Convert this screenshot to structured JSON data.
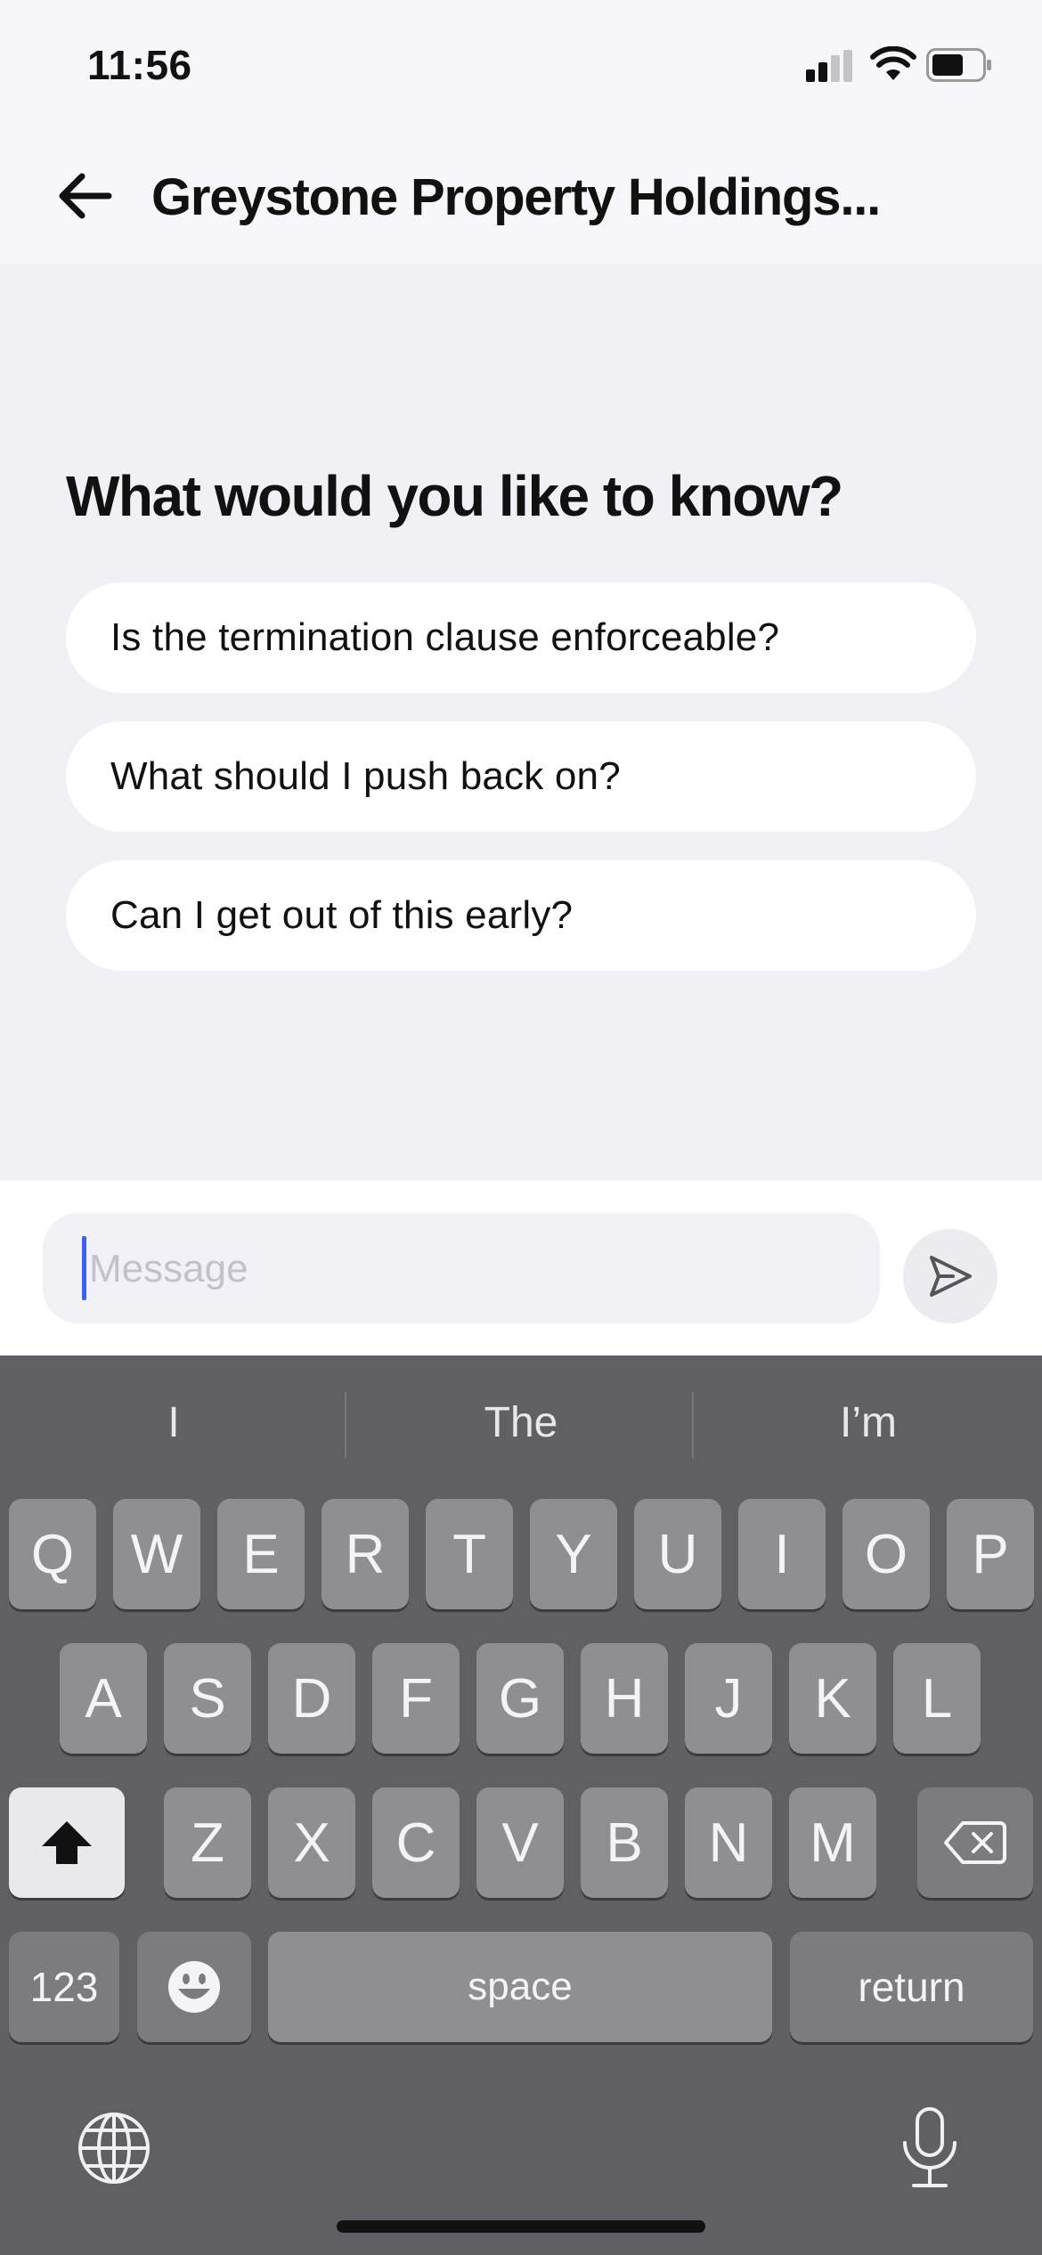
{
  "status_bar": {
    "time": "11:56"
  },
  "header": {
    "title": "Greystone Property Holdings..."
  },
  "main": {
    "prompt": "What would you like to know?",
    "suggestions": [
      "Is the termination clause enforceable?",
      "What should I push back on?",
      "Can I get out of this early?"
    ]
  },
  "composer": {
    "placeholder": "Message"
  },
  "keyboard": {
    "predictions": [
      "I",
      "The",
      "I’m"
    ],
    "row1": [
      "Q",
      "W",
      "E",
      "R",
      "T",
      "Y",
      "U",
      "I",
      "O",
      "P"
    ],
    "row2": [
      "A",
      "S",
      "D",
      "F",
      "G",
      "H",
      "J",
      "K",
      "L"
    ],
    "row3": [
      "Z",
      "X",
      "C",
      "V",
      "B",
      "N",
      "M"
    ],
    "numbers_label": "123",
    "space_label": "space",
    "return_label": "return"
  },
  "icons": [
    "back-arrow-icon",
    "cellular-signal-icon",
    "wifi-icon",
    "battery-icon",
    "send-icon",
    "shift-icon",
    "delete-icon",
    "emoji-icon",
    "globe-icon",
    "microphone-icon"
  ],
  "colors": {
    "caret": "#3c64dc",
    "keyboard_bg": "#606064",
    "key": "#8e8e93",
    "pill": "#ffffff"
  }
}
